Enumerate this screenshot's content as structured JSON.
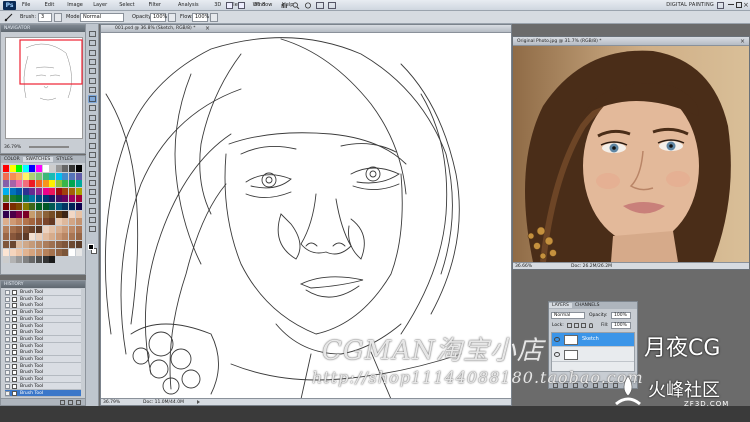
{
  "app": {
    "logo": "Ps",
    "menus": [
      "File",
      "Edit",
      "Image",
      "Layer",
      "Select",
      "Filter",
      "Analysis",
      "3D",
      "View",
      "Window",
      "Help"
    ],
    "zoom_value": "36.8",
    "workspace": "DIGITAL PAINTING"
  },
  "options": {
    "brush_label": "Brush:",
    "brush_size": "3",
    "mode_label": "Mode:",
    "mode_value": "Normal",
    "opacity_label": "Opacity:",
    "opacity_value": "100%",
    "flow_label": "Flow:",
    "flow_value": "100%"
  },
  "navigator": {
    "tab": "NAVIGATOR",
    "zoom": "36.79%"
  },
  "swatches": {
    "tabs": [
      "COLOR",
      "SWATCHES",
      "STYLES"
    ],
    "active_tab": "SWATCHES",
    "colors": [
      "#ff0000",
      "#ffff00",
      "#00ff00",
      "#00ffff",
      "#0000ff",
      "#ff00ff",
      "#ffffff",
      "#cccccc",
      "#999999",
      "#666666",
      "#333333",
      "#000000",
      "#f26c4f",
      "#f68e55",
      "#fbaf5d",
      "#fff467",
      "#acd372",
      "#7cc576",
      "#3bb878",
      "#1abbb4",
      "#00bff3",
      "#438cca",
      "#5574b9",
      "#605ca8",
      "#855fa8",
      "#a763a8",
      "#f06ea9",
      "#f26d7d",
      "#ed1c24",
      "#f26522",
      "#f7941d",
      "#fff200",
      "#8dc63f",
      "#39b54a",
      "#00a651",
      "#00a99d",
      "#00aeef",
      "#0072bc",
      "#0054a6",
      "#2e3192",
      "#662d91",
      "#92278f",
      "#ec008c",
      "#ed145b",
      "#9e0b0f",
      "#a0410d",
      "#a36209",
      "#aba000",
      "#598527",
      "#1a7b30",
      "#007236",
      "#00746b",
      "#0076a3",
      "#004a80",
      "#003471",
      "#1b1464",
      "#440e62",
      "#630460",
      "#9e005d",
      "#9e0039",
      "#790000",
      "#7b2e00",
      "#7d4900",
      "#827b00",
      "#406618",
      "#005e20",
      "#005826",
      "#005952",
      "#005b7f",
      "#003663",
      "#002157",
      "#0d004c",
      "#32004b",
      "#4b0049",
      "#7b0046",
      "#7a0026",
      "#c69c6d",
      "#a67c52",
      "#8c6239",
      "#754c24",
      "#603913",
      "#3c2415",
      "#f2d7c4",
      "#e8c2a4",
      "#dcae8c",
      "#cf9a74",
      "#c2865f",
      "#b3744c",
      "#a3643e",
      "#8f5434",
      "#7a452b",
      "#643822",
      "#e9cbb4",
      "#deb89c",
      "#d2a585",
      "#c4926f",
      "#b5805c",
      "#a46f4c",
      "#935f3f",
      "#7f5034",
      "#6b432b",
      "#573623",
      "#ecd2c0",
      "#e3c0a6",
      "#d8ae8f",
      "#cb9b79",
      "#bd8966",
      "#ac7755",
      "#9b6747",
      "#88573b",
      "#734932",
      "#5e3b28",
      "#f4e1d2",
      "#eccfb9",
      "#e2bda1",
      "#d6ab8b",
      "#c99876",
      "#b98663",
      "#a87553",
      "#956545",
      "#80563a",
      "#6b4730",
      "#d9b89c",
      "#cfa98a",
      "#c49a79",
      "#b88b69",
      "#ab7d5c",
      "#9d6f4f",
      "#8e6244",
      "#7e553a",
      "#6d4931",
      "#5c3d29",
      "#fbe4d3",
      "#f5d5bd",
      "#edc5a7",
      "#e2b491",
      "#d5a37d",
      "#c6926b",
      "#b6825b",
      "#a4724e",
      "#906343",
      "#7b5539",
      "#ffffff",
      "#e6e6e6",
      "#cccccc",
      "#b3b3b3",
      "#999999",
      "#808080",
      "#666666",
      "#4d4d4d",
      "#333333",
      "#1a1a1a"
    ]
  },
  "history": {
    "tab": "HISTORY",
    "items": [
      "Brush Tool",
      "Brush Tool",
      "Brush Tool",
      "Brush Tool",
      "Brush Tool",
      "Brush Tool",
      "Brush Tool",
      "Brush Tool",
      "Brush Tool",
      "Brush Tool",
      "Brush Tool",
      "Brush Tool",
      "Brush Tool",
      "Brush Tool",
      "Brush Tool",
      "Brush Tool"
    ],
    "selected_index": 15
  },
  "document": {
    "tab": "001.psd @ 36.8% (Sketch, RGB/8) *",
    "zoom": "36.79%",
    "doc_size": "Doc: 11.0M/44.0M"
  },
  "photo": {
    "tab": "Original Photo.jpg @ 31.7% (RGB/8) *",
    "zoom": "36.66%",
    "doc_size": "Doc: 26.2M/26.2M"
  },
  "layers": {
    "tabs": [
      "LAYERS",
      "CHANNELS"
    ],
    "blend_mode": "Normal",
    "opacity_label": "Opacity:",
    "opacity_value": "100%",
    "lock_label": "Lock:",
    "fill_label": "Fill:",
    "fill_value": "100%",
    "rows": [
      {
        "name": "Sketch",
        "selected": true
      },
      {
        "name": "",
        "selected": false
      }
    ]
  },
  "watermarks": {
    "shop": "CGMAN淘宝小店",
    "brand": "月夜CG",
    "url": "http://shop11144088180.taobao.com",
    "site": "火峰社区",
    "site_url": "ZF3D.COM"
  }
}
